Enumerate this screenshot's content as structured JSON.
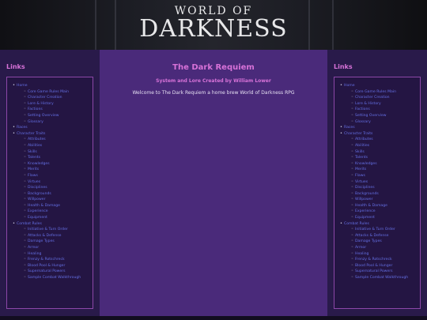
{
  "banner": {
    "line1": "WORLD OF",
    "line2": "DARKNESS"
  },
  "sidebar": {
    "title": "Links",
    "items": [
      {
        "label": "Home",
        "children": [
          "Core Game Rules Main",
          "Character Creation",
          "Lore & History",
          "Factions",
          "Setting Overview",
          "Glossary"
        ]
      },
      {
        "label": "Races",
        "children": []
      },
      {
        "label": "Character Traits",
        "children": [
          "Attributes",
          "Abilities",
          "Skills",
          "Talents",
          "Knowledges",
          "Merits",
          "Flaws",
          "Virtues",
          "Disciplines",
          "Backgrounds",
          "Willpower",
          "Health & Damage",
          "Experience",
          "Equipment"
        ]
      },
      {
        "label": "Combat Rules",
        "children": [
          "Initiative & Turn Order",
          "Attacks & Defense",
          "Damage Types",
          "Armor",
          "Healing",
          "Frenzy & Rotschreck",
          "Blood Pool & Hunger",
          "Supernatural Powers",
          "Sample Combat Walkthrough"
        ]
      }
    ]
  },
  "main": {
    "title": "The Dark Requiem",
    "subtitle": "System and Lore Created by William Lower",
    "welcome": "Welcome to The Dark Requiem a home brew World of Darkness RPG"
  }
}
